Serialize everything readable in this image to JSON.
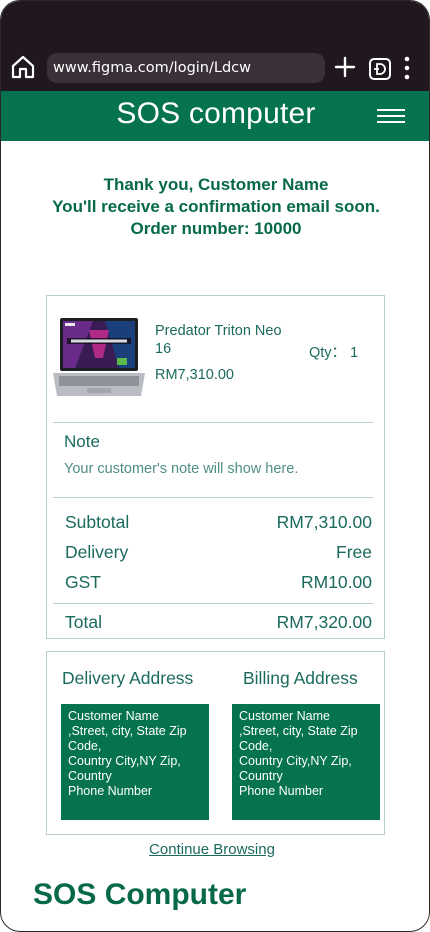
{
  "browser": {
    "url": "www.figma.com/login/Ldcw"
  },
  "header": {
    "title": "SOS computer"
  },
  "confirmation": {
    "line1": "Thank you, Customer Name",
    "line2": "You'll receive a confirmation email soon.",
    "line3": "Order number: 10000"
  },
  "order": {
    "product": {
      "name": "Predator Triton Neo 16",
      "price": "RM7,310.00",
      "qty_label": "Qty： 1"
    },
    "note": {
      "title": "Note",
      "text": "Your customer's note will show here."
    },
    "summary": [
      {
        "label": "Subtotal",
        "value": "RM7,310.00"
      },
      {
        "label": "Delivery",
        "value": "Free"
      },
      {
        "label": "GST",
        "value": "RM10.00"
      }
    ],
    "total": {
      "label": "Total",
      "value": "RM7,320.00"
    }
  },
  "addresses": {
    "delivery": {
      "title": "Delivery Address",
      "lines": [
        "Customer Name",
        ",Street, city, State Zip Code,",
        "Country City,NY Zip, Country",
        "Phone Number"
      ]
    },
    "billing": {
      "title": "Billing Address",
      "lines": [
        "Customer Name",
        ",Street, city, State Zip Code,",
        "Country City,NY Zip, Country",
        "Phone Number"
      ]
    }
  },
  "continue_label": "Continue Browsing",
  "footer": {
    "brand": "SOS Computer"
  },
  "colors": {
    "brand_green": "#05734f",
    "browser_bg": "#21171e"
  },
  "icons": [
    "home-icon",
    "plus-icon",
    "tab-switcher-icon",
    "more-vertical-icon",
    "hamburger-menu-icon"
  ]
}
